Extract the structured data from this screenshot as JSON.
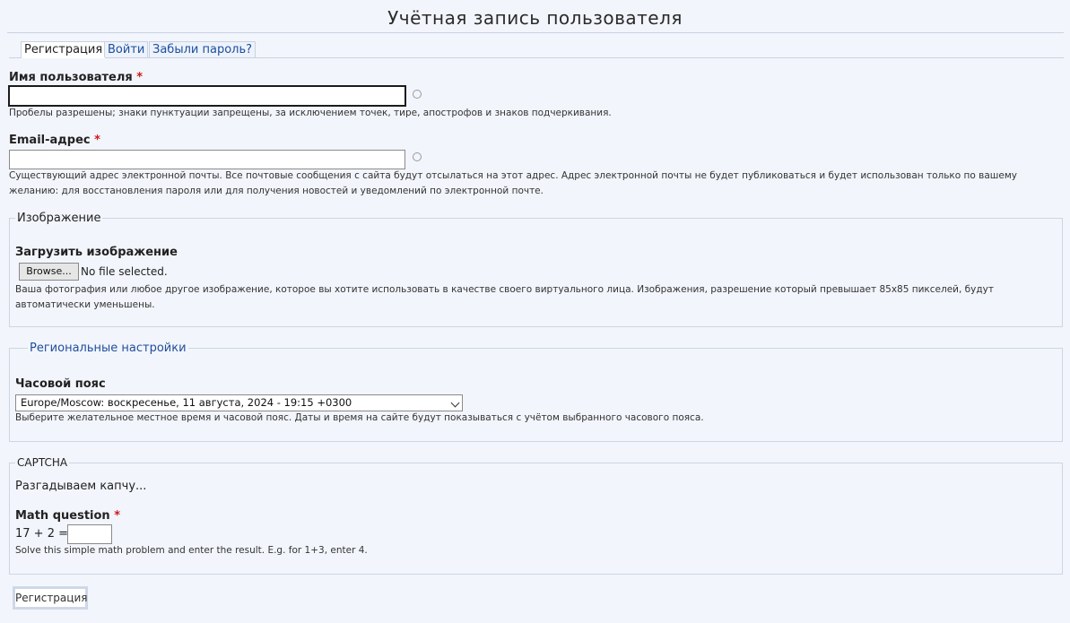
{
  "page": {
    "title": "Учётная запись пользователя"
  },
  "tabs": [
    {
      "label": "Регистрация"
    },
    {
      "label": "Войти"
    },
    {
      "label": "Забыли пароль?"
    }
  ],
  "username": {
    "label": "Имя пользователя",
    "required_mark": "*",
    "value": "",
    "description": "Пробелы разрешены; знаки пунктуации запрещены, за исключением точек, тире, апострофов и знаков подчеркивания."
  },
  "email": {
    "label": "Email-адрес",
    "required_mark": "*",
    "value": "",
    "description_line1": "Существующий адрес электронной почты. Все почтовые сообщения с сайта будут отсылаться на этот адрес. Адрес электронной почты не будет публиковаться и будет использован только по вашему",
    "description_line2": "желанию: для восстановления пароля или для получения новостей и уведомлений по электронной почте."
  },
  "image_section": {
    "legend": "Изображение",
    "upload_label": "Загрузить изображение",
    "browse_label": "Browse...",
    "file_status": "No file selected.",
    "description_line1": "Ваша фотография или любое другое изображение, которое вы хотите использовать в качестве своего виртуального лица. Изображения, разрешение который превышает 85x85 пикселей, будут",
    "description_line2": "автоматически уменьшены."
  },
  "regional_section": {
    "legend": "Региональные настройки",
    "timezone_label": "Часовой пояс",
    "timezone_value": "Europe/Moscow: воскресенье, 11 августа, 2024 - 19:15 +0300",
    "description": "Выберите желательное местное время и часовой пояс. Даты и время на сайте будут показываться с учётом выбранного часового пояса."
  },
  "captcha_section": {
    "legend": "CAPTCHA",
    "intro": "Разгадываем капчу...",
    "math_label": "Math question",
    "required_mark": "*",
    "question": "17 + 2 =",
    "answer": "",
    "description": "Solve this simple math problem and enter the result. E.g. for 1+3, enter 4."
  },
  "submit": {
    "label": "Регистрация"
  },
  "colors": {
    "background": "#f2f5fb",
    "link": "#1a4fa0",
    "required": "#cc1a1a",
    "border": "#cdd5e4"
  }
}
